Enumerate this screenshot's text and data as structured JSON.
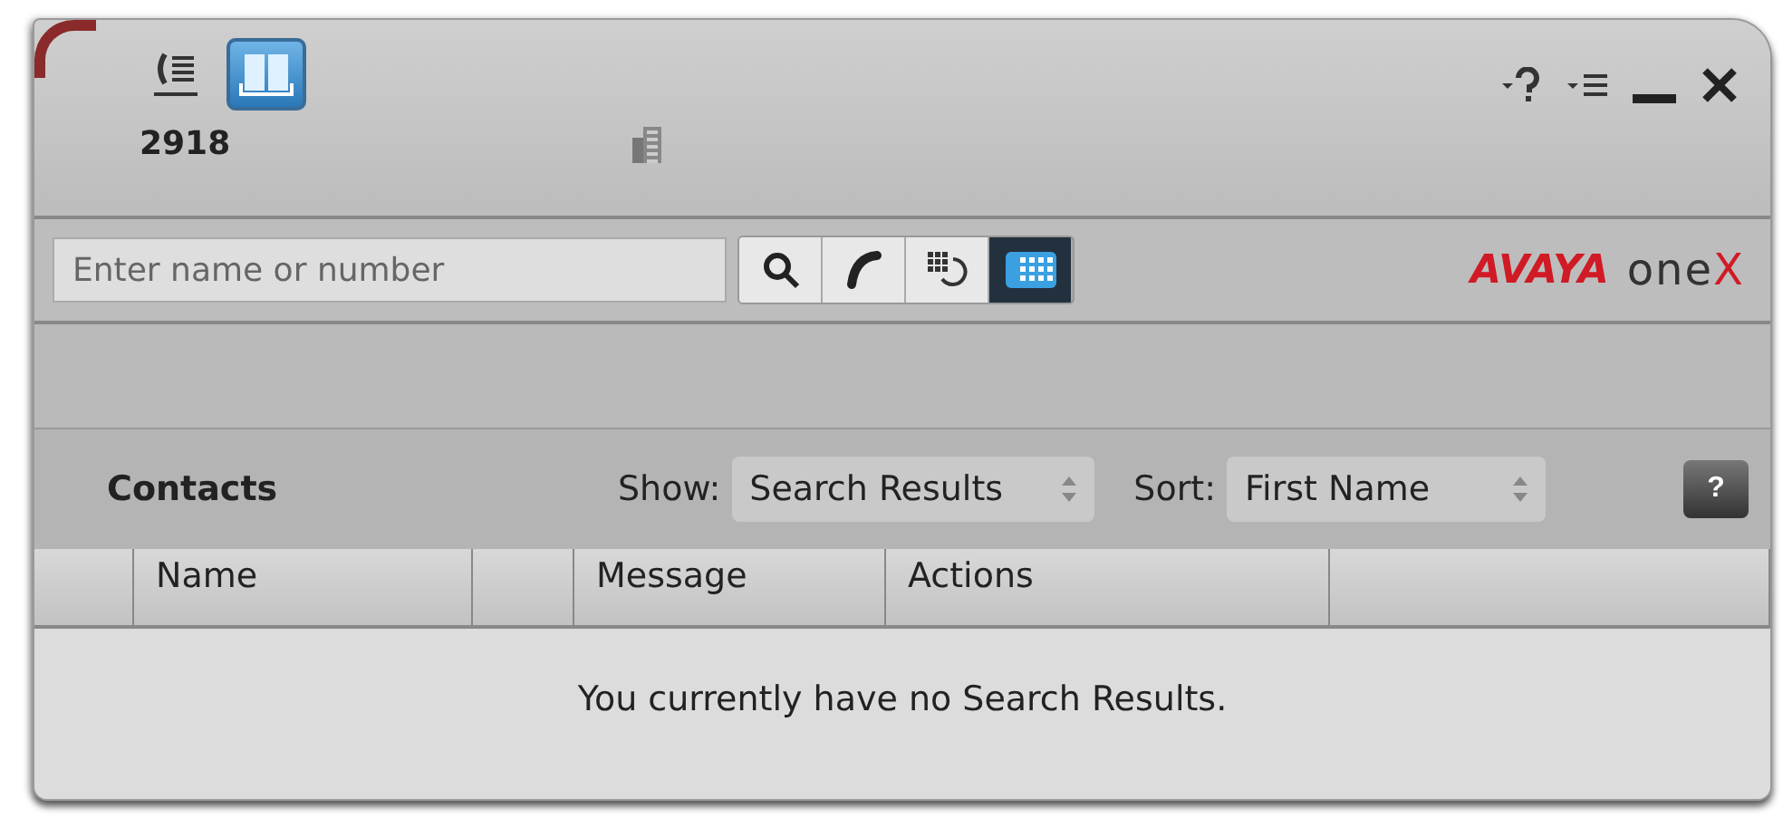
{
  "header": {
    "tabs": [
      {
        "kind": "call-log",
        "selected": false
      },
      {
        "kind": "contacts",
        "selected": true
      }
    ],
    "extension": "2918"
  },
  "window_controls": [
    {
      "kind": "help"
    },
    {
      "kind": "menu"
    },
    {
      "kind": "minimize"
    },
    {
      "kind": "close"
    }
  ],
  "toolbar": {
    "search": {
      "placeholder": "Enter name or number"
    },
    "buttons": [
      {
        "kind": "search",
        "selected": false
      },
      {
        "kind": "call",
        "selected": false
      },
      {
        "kind": "redial",
        "selected": false
      },
      {
        "kind": "dialpad",
        "selected": true
      }
    ],
    "logo": {
      "brand": "AVAYA",
      "product": "one",
      "mark": "X"
    }
  },
  "contacts_bar": {
    "title": "Contacts",
    "show_label": "Show:",
    "show_value": "Search Results",
    "sort_label": "Sort:",
    "sort_value": "First Name",
    "help": "?"
  },
  "table": {
    "columns": [
      {},
      {
        "label": "Name"
      },
      {},
      {
        "label": "Message"
      },
      {
        "label": "Actions"
      },
      {}
    ],
    "empty_message": "You currently have no Search Results."
  }
}
